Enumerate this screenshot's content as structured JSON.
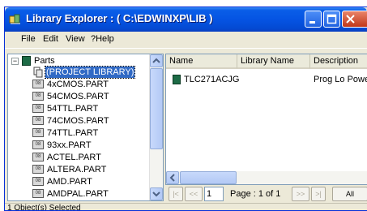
{
  "window": {
    "title": "Library Explorer : ( C:\\EDWINXP\\LIB )"
  },
  "menu": [
    {
      "label": "File"
    },
    {
      "label": "Edit"
    },
    {
      "label": "View"
    },
    {
      "label": "?Help"
    }
  ],
  "tree": {
    "root": {
      "label": "Parts",
      "toggle": "−"
    },
    "project_item": {
      "label": "(PROJECT LIBRARY)",
      "selected": true
    },
    "items": [
      {
        "label": "4xCMOS.PART"
      },
      {
        "label": "54CMOS.PART"
      },
      {
        "label": "54TTL.PART"
      },
      {
        "label": "74CMOS.PART"
      },
      {
        "label": "74TTL.PART"
      },
      {
        "label": "93xx.PART"
      },
      {
        "label": "ACTEL.PART"
      },
      {
        "label": "ALTERA.PART"
      },
      {
        "label": "AMD.PART"
      },
      {
        "label": "AMDPAL.PART"
      }
    ]
  },
  "list": {
    "columns": [
      {
        "label": "Name"
      },
      {
        "label": "Library Name"
      },
      {
        "label": "Description"
      }
    ],
    "rows": [
      {
        "name": "TLC271ACJG",
        "library": "",
        "description": "Prog Lo Power"
      }
    ]
  },
  "pager": {
    "first": "|<",
    "prev": "<<",
    "page_input": "1",
    "page_text": "Page : 1 of 1",
    "next": ">>",
    "last": ">|",
    "filter": "All"
  },
  "status": {
    "text": "1 Object(s) Selected"
  },
  "colors": {
    "titlebar": "#0554e3",
    "selection": "#316ac5",
    "window_bg": "#ece9d8"
  }
}
